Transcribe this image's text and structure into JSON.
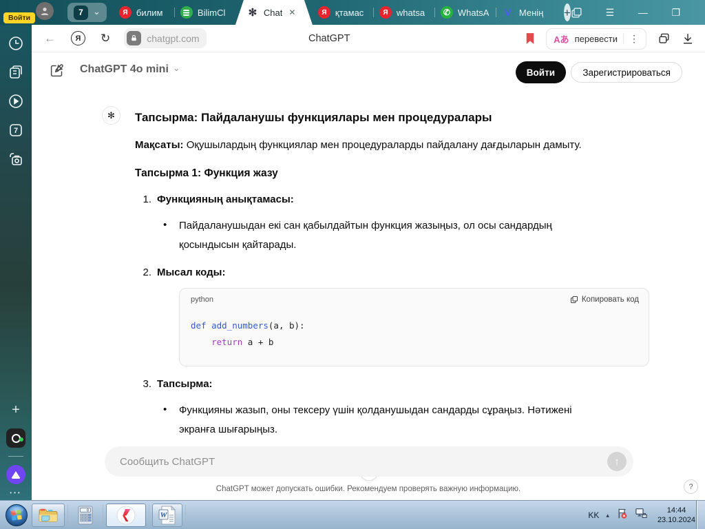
{
  "glyphs": {
    "back": "←",
    "reload": "↻",
    "chevron_down": "⌄",
    "plus": "+",
    "menu": "☰",
    "minimize": "—",
    "restore": "❐",
    "close": "✕",
    "tab_close": "✕",
    "arrow_down": "↓",
    "arrow_up": "↑",
    "question": "?",
    "dots_v": "⋮",
    "yandex_letter": "Я",
    "whatsapp_phone": "✆",
    "v_letter": "V",
    "knot": "✻",
    "person": "👤",
    "bullet": "•",
    "ellipsis": "•••",
    "tri_up": "▴"
  },
  "browser": {
    "profile_login": "Войти",
    "tab_count": "7",
    "tabs": [
      {
        "label": "билим"
      },
      {
        "label": "BilimCl"
      },
      {
        "label": "Chat"
      },
      {
        "label": "қтамас"
      },
      {
        "label": "whatsa"
      },
      {
        "label": "WhatsA"
      },
      {
        "label": "Менің"
      }
    ],
    "url": "chatgpt.com",
    "page_title": "ChatGPT",
    "translate_icon": "Aあ",
    "translate_label": "перевести"
  },
  "chat": {
    "model": "ChatGPT 4o mini",
    "login": "Войти",
    "signup": "Зарегистрироваться",
    "title": "Тапсырма: Пайдаланушы функциялары мен процедуралары",
    "goal_label": "Мақсаты:",
    "goal_text": " Оқушылардың функциялар мен процедураларды пайдалану дағдыларын дамыту.",
    "subtitle": "Тапсырма 1: Функция жазу",
    "item1_num": "1.",
    "item1_title": "Функцияның анықтамасы:",
    "item1_bullet": "Пайдаланушыдан екі сан қабылдайтын функция жазыңыз, ол осы сандардың қосындысын қайтарады.",
    "item2_num": "2.",
    "item2_title": "Мысал коды:",
    "item3_num": "3.",
    "item3_title": "Тапсырма:",
    "item3_bullet": "Функцияны жазып, оны тексеру үшін қолданушыдан сандарды сұраңыз. Нәтижені экранға шығарыңыз.",
    "code": {
      "lang": "python",
      "copy": "Копировать код",
      "kw1": "def",
      "sp1": " ",
      "fn": "add_numbers",
      "rest1": "(a, b):",
      "indent": "    ",
      "kw2": "return",
      "rest2": " a + b"
    },
    "composer_placeholder": "Сообщить ChatGPT",
    "disclaimer": "ChatGPT может допускать ошибки. Рекомендуем проверять важную информацию."
  },
  "taskbar": {
    "lang": "KK",
    "time": "14:44",
    "date": "23.10.2024"
  },
  "colors": {
    "tabbar_left": "#13505a",
    "tabbar_right": "#4a97a3",
    "bookmark_red": "#e5484d",
    "login_black": "#0d0d0d",
    "badge_yellow": "#fcd525",
    "alice_purple": "#6f46f2",
    "code_keyword_blue": "#3558cf",
    "code_return_purple": "#a43bbf"
  }
}
